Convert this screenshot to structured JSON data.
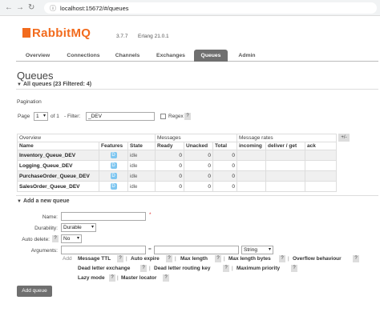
{
  "browser": {
    "url": "localhost:15672/#/queues"
  },
  "header": {
    "logo": "RabbitMQ",
    "version": "3.7.7",
    "erlang": "Erlang 21.0.1"
  },
  "tabs": [
    {
      "label": "Overview"
    },
    {
      "label": "Connections"
    },
    {
      "label": "Channels"
    },
    {
      "label": "Exchanges"
    },
    {
      "label": "Queues"
    },
    {
      "label": "Admin"
    }
  ],
  "page": {
    "title": "Queues",
    "all_queues": "All queues (23 Filtered: 4)",
    "pagination_label": "Pagination",
    "page_label": "Page",
    "page_value": "1",
    "of_label": "of 1",
    "filter_label": "- Filter:",
    "filter_value": "_DEV",
    "regex_label": "Regex",
    "help_q": "?"
  },
  "table": {
    "group_headers": {
      "overview": "Overview",
      "messages": "Messages",
      "rates": "Message rates",
      "plusminus": "+/-"
    },
    "columns": [
      "Name",
      "Features",
      "State",
      "Ready",
      "Unacked",
      "Total",
      "incoming",
      "deliver / get",
      "ack"
    ],
    "rows": [
      {
        "name": "Inventory_Queue_DEV",
        "feature": "D",
        "state": "idle",
        "ready": "0",
        "unacked": "0",
        "total": "0"
      },
      {
        "name": "Logging_Queue_DEV",
        "feature": "D",
        "state": "idle",
        "ready": "0",
        "unacked": "0",
        "total": "0"
      },
      {
        "name": "PurchaseOrder_Queue_DEV",
        "feature": "D",
        "state": "idle",
        "ready": "0",
        "unacked": "0",
        "total": "0"
      },
      {
        "name": "SalesOrder_Queue_DEV",
        "feature": "D",
        "state": "idle",
        "ready": "0",
        "unacked": "0",
        "total": "0"
      }
    ]
  },
  "add_queue": {
    "heading": "Add a new queue",
    "name_label": "Name:",
    "required_mark": "*",
    "durability_label": "Durability:",
    "durability_value": "Durable",
    "auto_delete_label": "Auto delete:",
    "auto_delete_value": "No",
    "arguments_label": "Arguments:",
    "equals": "=",
    "arg_type": "String",
    "add_label": "Add",
    "options": [
      "Message TTL",
      "Auto expire",
      "Max length",
      "Max length bytes",
      "Overflow behaviour",
      "Dead letter exchange",
      "Dead letter routing key",
      "Maximum priority",
      "Lazy mode",
      "Master locator"
    ],
    "button": "Add queue"
  }
}
